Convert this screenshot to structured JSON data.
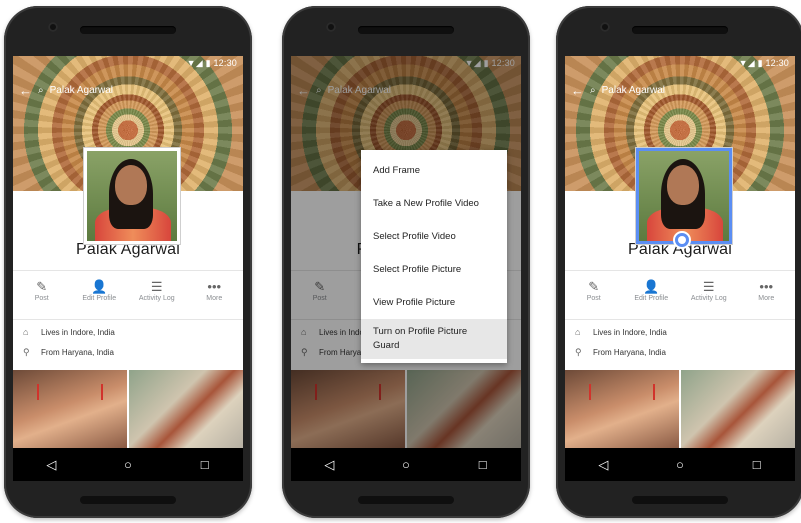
{
  "status": {
    "time": "12:30"
  },
  "search": {
    "text": "Palak Agarwal",
    "dim_text": "Palak Agarwal"
  },
  "profile": {
    "name": "Palak Agarwal",
    "partial_name_left": "P",
    "partial_name_right": "l"
  },
  "actions": [
    {
      "label": "Post",
      "icon": "pencil-square-icon"
    },
    {
      "label": "Edit Profile",
      "icon": "person-edit-icon"
    },
    {
      "label": "Activity Log",
      "icon": "list-icon"
    },
    {
      "label": "More",
      "icon": "ellipsis-icon"
    }
  ],
  "about": {
    "lives": "Lives in Indore, India",
    "from": "From Haryana, India",
    "lives_partial": "Lives in Indo",
    "from_partial": "From Harya"
  },
  "menu": [
    "Add Frame",
    "Take a New Profile Video",
    "Select Profile Video",
    "Select Profile Picture",
    "View Profile Picture",
    "Turn on Profile Picture Guard"
  ],
  "nav": {
    "back": "◁",
    "home": "○",
    "recents": "□"
  },
  "colors": {
    "guard_ring": "#5b8ef3",
    "screen_bg": "#ffffff",
    "nav_bg": "#000000"
  }
}
